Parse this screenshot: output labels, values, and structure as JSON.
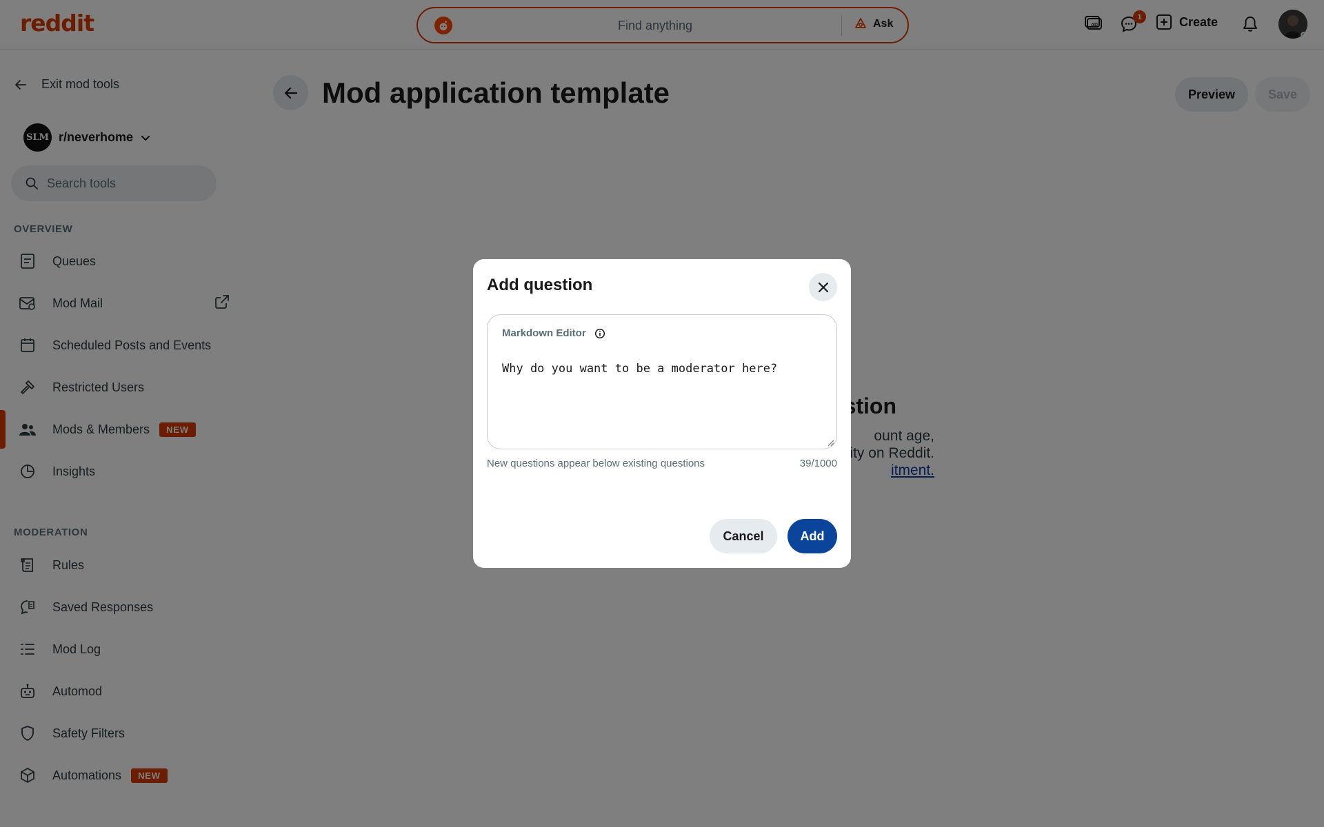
{
  "header": {
    "logo_text": "reddit",
    "search_placeholder": "Find anything",
    "ask_label": "Ask",
    "chat_badge_count": "1",
    "create_label": "Create"
  },
  "sidebar": {
    "exit_label": "Exit mod tools",
    "community_name": "r/neverhome",
    "community_avatar_text": "SLM",
    "search_placeholder": "Search tools",
    "overview_title": "OVERVIEW",
    "overview_items": [
      {
        "label": "Queues",
        "icon": "queue-icon"
      },
      {
        "label": "Mod Mail",
        "icon": "modmail-icon"
      },
      {
        "label": "Scheduled Posts and Events",
        "icon": "calendar-icon"
      },
      {
        "label": "Restricted Users",
        "icon": "hammer-icon"
      },
      {
        "label": "Mods & Members",
        "icon": "members-icon",
        "badge": "NEW",
        "active": true
      },
      {
        "label": "Insights",
        "icon": "insights-icon"
      }
    ],
    "moderation_title": "MODERATION",
    "moderation_items": [
      {
        "label": "Rules",
        "icon": "rules-icon"
      },
      {
        "label": "Saved Responses",
        "icon": "saved-responses-icon"
      },
      {
        "label": "Mod Log",
        "icon": "list-icon"
      },
      {
        "label": "Automod",
        "icon": "robot-icon"
      },
      {
        "label": "Safety Filters",
        "icon": "shield-icon"
      },
      {
        "label": "Automations",
        "icon": "cube-icon",
        "badge": "NEW"
      }
    ]
  },
  "main": {
    "title": "Mod application template",
    "preview_label": "Preview",
    "save_label": "Save",
    "empty_heading": "stion",
    "empty_line1": "ount age,",
    "empty_line2": "ity on Reddit.",
    "empty_link": "itment."
  },
  "modal": {
    "title": "Add question",
    "editor_label": "Markdown Editor",
    "question_text": "Why do you want to be a moderator here?",
    "helper_text": "New questions appear below existing questions",
    "char_count": "39/1000",
    "cancel_label": "Cancel",
    "add_label": "Add"
  },
  "colors": {
    "brand": "#d93a00",
    "primary_button": "#0a449b",
    "overlay": "rgba(0,0,0,0.5)"
  }
}
